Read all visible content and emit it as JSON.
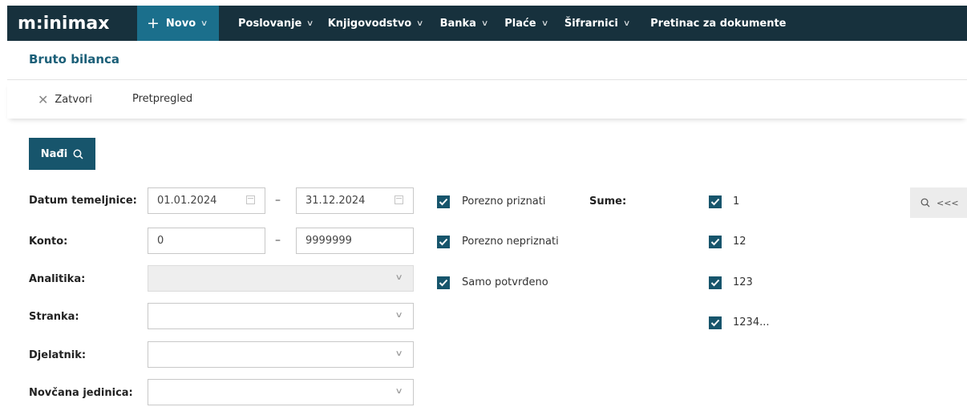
{
  "nav": {
    "logo": "m:inimax",
    "novo_plus": "+",
    "novo_label": "Novo",
    "items": [
      {
        "label": "Poslovanje",
        "has_chevron": true
      },
      {
        "label": "Knjigovodstvo",
        "has_chevron": true
      },
      {
        "label": "Banka",
        "has_chevron": true
      },
      {
        "label": "Plaće",
        "has_chevron": true
      },
      {
        "label": "Šifrarnici",
        "has_chevron": true
      },
      {
        "label": "Pretinac za dokumente",
        "has_chevron": false
      }
    ],
    "colors": {
      "bar": "#17313d",
      "novo": "#1b6f8c"
    }
  },
  "page": {
    "title": "Bruto bilanca"
  },
  "toolbar": {
    "close_label": "Zatvori",
    "preview_label": "Pretpregled"
  },
  "search": {
    "button_label": "Nađi",
    "side_label": "<<<"
  },
  "form": {
    "datum_label": "Datum temeljnice:",
    "date_from": "01.01.2024",
    "date_to": "31.12.2024",
    "konto_label": "Konto:",
    "konto_from": "0",
    "konto_to": "9999999",
    "analitika_label": "Analitika:",
    "stranka_label": "Stranka:",
    "djelatnik_label": "Djelatnik:",
    "valuta_label": "Novčana jedinica:",
    "range_separator": "–"
  },
  "options": [
    {
      "label": "Porezno priznati",
      "checked": true
    },
    {
      "label": "Porezno nepriznati",
      "checked": true
    },
    {
      "label": "Samo potvrđeno",
      "checked": true
    }
  ],
  "sums": {
    "label": "Sume:",
    "items": [
      {
        "label": "1",
        "checked": true
      },
      {
        "label": "12",
        "checked": true
      },
      {
        "label": "123",
        "checked": true
      },
      {
        "label": "1234...",
        "checked": true
      }
    ]
  },
  "accent": "#17556c"
}
